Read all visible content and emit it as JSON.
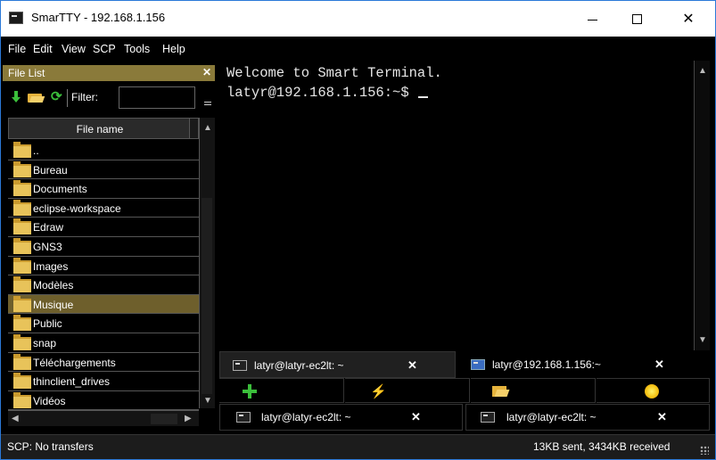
{
  "window": {
    "title": "SmarTTY - 192.168.1.156",
    "controls": {
      "minimize": "",
      "maximize": "",
      "close": "✕"
    }
  },
  "menu": [
    "File",
    "Edit",
    "View",
    "SCP",
    "Tools",
    "Help"
  ],
  "file_list": {
    "title": "File List",
    "close_label": "✕",
    "filter_label": "Filter:",
    "filter_value": "",
    "column_header": "File name",
    "items": [
      {
        "name": "..",
        "selected": false
      },
      {
        "name": "Bureau",
        "selected": false
      },
      {
        "name": "Documents",
        "selected": false
      },
      {
        "name": "eclipse-workspace",
        "selected": false
      },
      {
        "name": "Edraw",
        "selected": false
      },
      {
        "name": "GNS3",
        "selected": false
      },
      {
        "name": "Images",
        "selected": false
      },
      {
        "name": "Modèles",
        "selected": false
      },
      {
        "name": "Musique",
        "selected": true
      },
      {
        "name": "Public",
        "selected": false
      },
      {
        "name": "snap",
        "selected": false
      },
      {
        "name": "Téléchargements",
        "selected": false
      },
      {
        "name": "thinclient_drives",
        "selected": false
      },
      {
        "name": "Vidéos",
        "selected": false
      }
    ],
    "icons": {
      "download": "down-arrow-icon",
      "open": "open-folder-icon",
      "refresh": "refresh-icon"
    }
  },
  "terminal": {
    "lines": [
      "Welcome to Smart Terminal.",
      "latyr@192.168.1.156:~$"
    ]
  },
  "tabs_top": [
    {
      "label": "latyr@latyr-ec2lt: ~",
      "close": "✕",
      "active": true
    },
    {
      "label": "latyr@192.168.1.156:~",
      "close": "✕",
      "active": false
    }
  ],
  "actions": [
    {
      "icon": "plus-icon",
      "name": "new-session"
    },
    {
      "icon": "lightning-icon",
      "name": "quick-connect",
      "glyph": "⚡"
    },
    {
      "icon": "folder-icon",
      "name": "open-folder"
    },
    {
      "icon": "sun-icon",
      "name": "settings"
    }
  ],
  "tabs_bottom": [
    {
      "label": "latyr@latyr-ec2lt: ~",
      "close": "✕"
    },
    {
      "label": "latyr@latyr-ec2lt: ~",
      "close": "✕"
    }
  ],
  "status": {
    "left": "SCP: No transfers",
    "right": "13KB sent, 3434KB received"
  },
  "colors": {
    "panel_header": "#8a7a3a",
    "selection": "#6e5f2c",
    "background": "#000000",
    "folder": "#e8c35a"
  }
}
